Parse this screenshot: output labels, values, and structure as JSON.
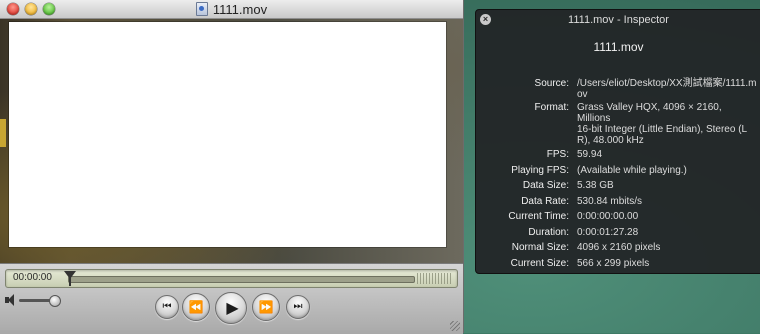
{
  "player": {
    "title": "1111.mov",
    "timecode": "00:00:00"
  },
  "inspector": {
    "title": "1111.mov - Inspector",
    "filename": "1111.mov",
    "rows": [
      {
        "label": "Source:",
        "value": "/Users/eliot/Desktop/XX測試檔案/1111.mov"
      },
      {
        "label": "Format:",
        "value": "Grass Valley HQX, 4096 × 2160, Millions\n16-bit Integer (Little Endian), Stereo (L R), 48.000 kHz"
      },
      {
        "label": "FPS:",
        "value": "59.94"
      },
      {
        "label": "Playing FPS:",
        "value": "(Available while playing.)"
      },
      {
        "label": "Data Size:",
        "value": "5.38 GB"
      },
      {
        "label": "Data Rate:",
        "value": "530.84 mbits/s"
      },
      {
        "label": "Current Time:",
        "value": "0:00:00:00.00"
      },
      {
        "label": "Duration:",
        "value": "0:00:01:27.28"
      },
      {
        "label": "Normal Size:",
        "value": "4096 x 2160 pixels"
      },
      {
        "label": "Current Size:",
        "value": "566 x 299 pixels"
      }
    ]
  },
  "icons": {
    "close": "close-icon",
    "minimize": "minimize-icon",
    "zoom": "zoom-icon",
    "document": "document-icon",
    "speaker": "speaker-icon",
    "go_to_start": "skip-to-start-icon",
    "rewind": "rewind-icon",
    "play": "play-icon",
    "fast_forward": "fast-forward-icon",
    "go_to_end": "skip-to-end-icon"
  },
  "colors": {
    "desktop": "#3f7a66",
    "inspector_bg": "#222426",
    "timebar": "#dfe3cd"
  }
}
